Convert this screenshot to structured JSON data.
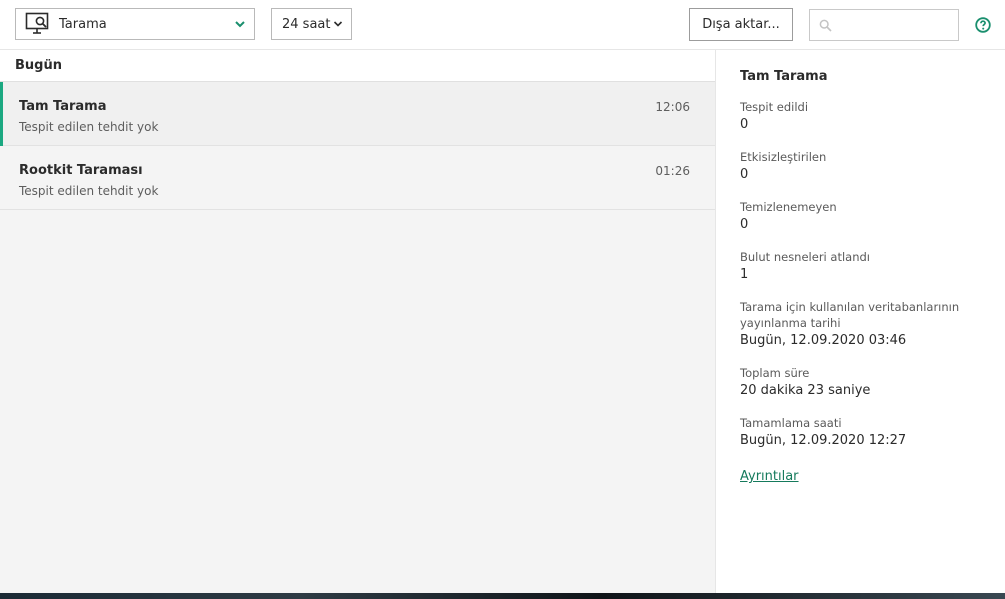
{
  "toolbar": {
    "report_type": "Tarama",
    "period": "24 saat",
    "export_label": "Dışa aktar...",
    "search_value": "",
    "search_placeholder": ""
  },
  "list": {
    "section": "Bugün",
    "items": [
      {
        "title": "Tam Tarama",
        "subtitle": "Tespit edilen tehdit yok",
        "time": "12:06",
        "selected": true
      },
      {
        "title": "Rootkit Taraması",
        "subtitle": "Tespit edilen tehdit yok",
        "time": "01:26",
        "selected": false
      }
    ]
  },
  "details": {
    "title": "Tam Tarama",
    "fields": [
      {
        "label": "Tespit edildi",
        "value": "0"
      },
      {
        "label": "Etkisizleştirilen",
        "value": "0"
      },
      {
        "label": "Temizlenemeyen",
        "value": "0"
      },
      {
        "label": "Bulut nesneleri atlandı",
        "value": "1"
      },
      {
        "label": "Tarama için kullanılan veritabanlarının yayınlanma tarihi",
        "value": "Bugün, 12.09.2020 03:46"
      },
      {
        "label": "Toplam süre",
        "value": "20 dakika 23 saniye"
      },
      {
        "label": "Tamamlama saati",
        "value": "Bugün, 12.09.2020 12:27"
      }
    ],
    "link": "Ayrıntılar"
  },
  "colors": {
    "accent": "#1ba881",
    "link": "#157a5c",
    "help": "#1a8f6e"
  },
  "icons": {
    "report_type": "monitor-search-icon",
    "dropdown": "chevron-down-icon",
    "search": "search-icon",
    "help": "help-icon"
  }
}
